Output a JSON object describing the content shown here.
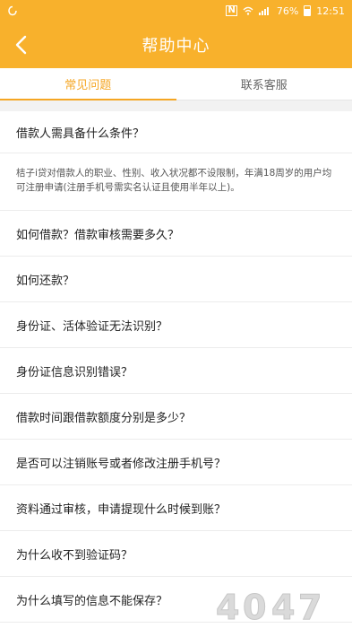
{
  "status_bar": {
    "battery": "76%",
    "time": "12:51",
    "signal_icons": [
      "nfc-icon",
      "wifi-icon",
      "signal-icon",
      "battery-icon"
    ]
  },
  "header": {
    "title": "帮助中心",
    "back_icon": "chevron-left-icon"
  },
  "tabs": [
    {
      "label": "常见问题",
      "active": true
    },
    {
      "label": "联系客服",
      "active": false
    }
  ],
  "faq": {
    "first_question": "借款人需具备什么条件？",
    "first_answer": "桔子i贷对借款人的职业、性别、收入状况都不设限制，年满18周岁的用户均可注册申请(注册手机号需实名认证且使用半年以上)。",
    "questions": [
      "如何借款？借款审核需要多久？",
      "如何还款？",
      "身份证、活体验证无法识别？",
      "身份证信息识别错误？",
      "借款时间跟借款额度分别是多少？",
      "是否可以注销账号或者修改注册手机号？",
      "资料通过审核，申请提现什么时候到账？",
      "为什么收不到验证码？",
      "为什么填写的信息不能保存？"
    ]
  },
  "colors": {
    "brand": "#f8b12c",
    "accent": "#f5a623"
  }
}
